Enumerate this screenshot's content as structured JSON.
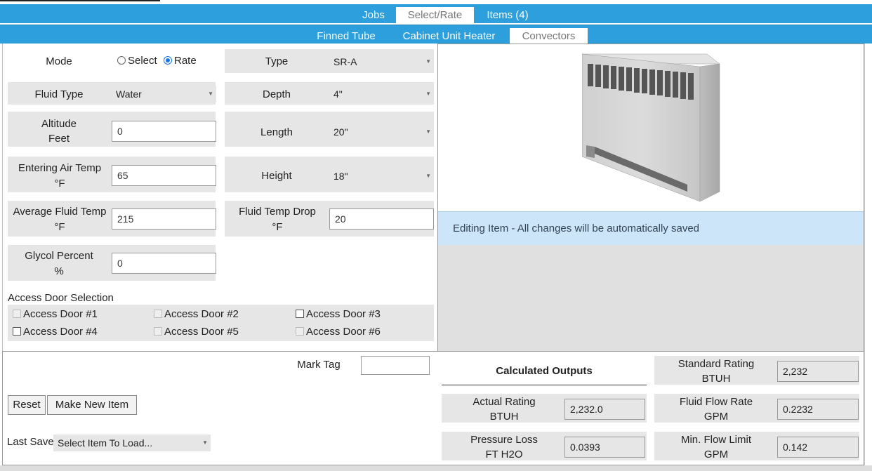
{
  "nav": {
    "tabs": [
      {
        "label": "Jobs",
        "active": false
      },
      {
        "label": "Select/Rate",
        "active": true
      },
      {
        "label": "Items (4)",
        "active": false
      }
    ],
    "subtabs": [
      {
        "label": "Finned Tube",
        "active": false
      },
      {
        "label": "Cabinet Unit Heater",
        "active": false
      },
      {
        "label": "Convectors",
        "active": true
      }
    ]
  },
  "form": {
    "mode": {
      "label": "Mode",
      "option_select": "Select",
      "option_rate": "Rate",
      "selected": "Rate"
    },
    "fluid_type": {
      "label": "Fluid Type",
      "value": "Water"
    },
    "altitude": {
      "label": "Altitude",
      "unit": "Feet",
      "value": "0"
    },
    "entering_air_temp": {
      "label": "Entering Air Temp",
      "unit": "°F",
      "value": "65"
    },
    "average_fluid_temp": {
      "label": "Average Fluid Temp",
      "unit": "°F",
      "value": "215"
    },
    "glycol_percent": {
      "label": "Glycol Percent",
      "unit": "%",
      "value": "0"
    },
    "type": {
      "label": "Type",
      "value": "SR-A"
    },
    "depth": {
      "label": "Depth",
      "value": "4\""
    },
    "length": {
      "label": "Length",
      "value": "20\""
    },
    "height": {
      "label": "Height",
      "value": "18\""
    },
    "fluid_temp_drop": {
      "label": "Fluid Temp Drop",
      "unit": "°F",
      "value": "20"
    },
    "access_door_heading": "Access Door Selection",
    "access_doors": [
      {
        "label": "Access Door #1",
        "enabled": false,
        "checked": false
      },
      {
        "label": "Access Door #2",
        "enabled": false,
        "checked": false
      },
      {
        "label": "Access Door #3",
        "enabled": true,
        "checked": false
      },
      {
        "label": "Access Door #4",
        "enabled": true,
        "checked": false
      },
      {
        "label": "Access Door #5",
        "enabled": false,
        "checked": false
      },
      {
        "label": "Access Door #6",
        "enabled": false,
        "checked": false
      }
    ]
  },
  "status": {
    "editing_message": "Editing Item - All changes will be automatically saved"
  },
  "actions": {
    "mark_tag_label": "Mark Tag",
    "mark_tag_value": "",
    "reset_label": "Reset",
    "make_new_item_label": "Make New Item",
    "last_save_label": "Last Save",
    "last_save_value": "Select Item To Load..."
  },
  "outputs": {
    "heading": "Calculated Outputs",
    "standard_rating": {
      "label": "Standard Rating",
      "unit": "BTUH",
      "value": "2,232"
    },
    "actual_rating": {
      "label": "Actual Rating",
      "unit": "BTUH",
      "value": "2,232.0"
    },
    "fluid_flow_rate": {
      "label": "Fluid Flow Rate",
      "unit": "GPM",
      "value": "0.2232"
    },
    "pressure_loss": {
      "label": "Pressure Loss",
      "unit": "FT H2O",
      "value": "0.0393"
    },
    "min_flow_limit": {
      "label": "Min. Flow Limit",
      "unit": "GPM",
      "value": "0.142"
    }
  },
  "colors": {
    "nav": "#2c9fdc",
    "info_bar": "#cce5f8",
    "field_bg": "#e6e6e6"
  }
}
